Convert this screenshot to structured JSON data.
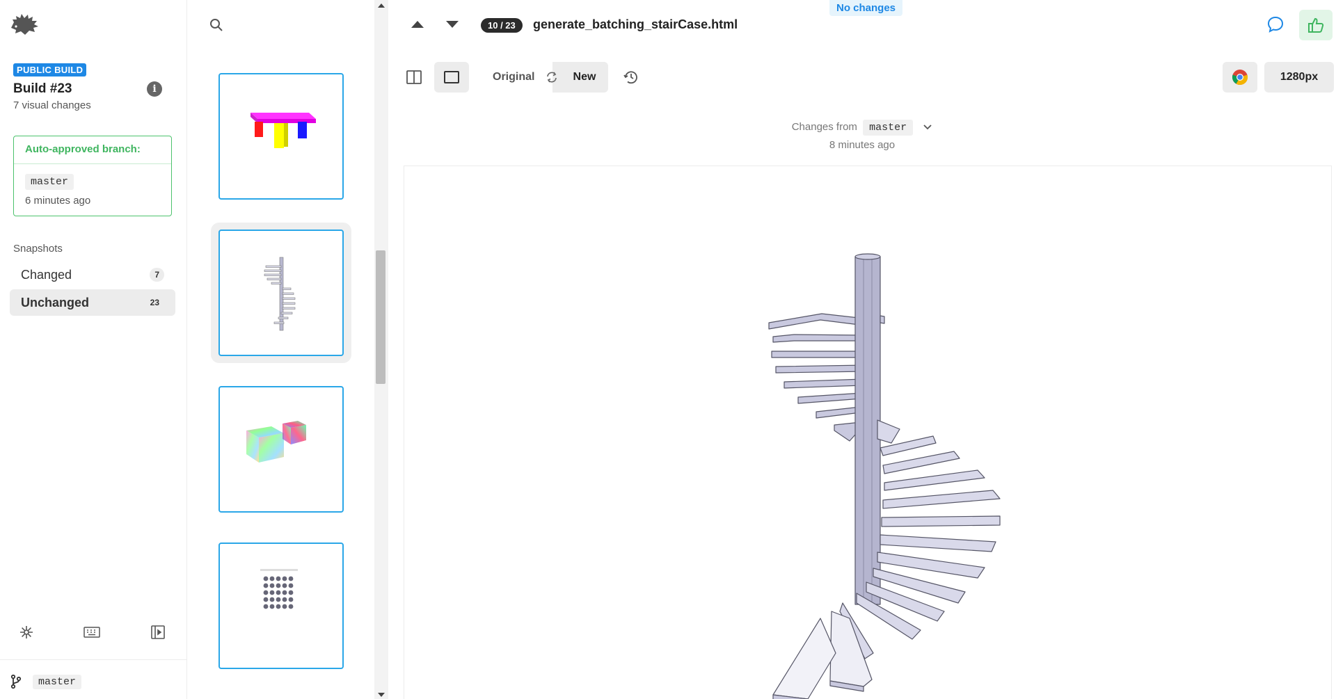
{
  "sidebar": {
    "badge": "PUBLIC BUILD",
    "build_title": "Build #23",
    "build_sub": "7 visual changes",
    "auto_approved": {
      "heading": "Auto-approved branch:",
      "branch": "master",
      "time": "6 minutes ago"
    },
    "snapshots_label": "Snapshots",
    "changed": {
      "label": "Changed",
      "count": "7"
    },
    "unchanged": {
      "label": "Unchanged",
      "count": "23"
    },
    "footer_branch": "master"
  },
  "main": {
    "status_tab": "No changes",
    "counter": "10 / 23",
    "file_name": "generate_batching_stairCase.html",
    "toggle_original": "Original",
    "toggle_new": "New",
    "viewport": "1280px",
    "changes_from_label": "Changes from",
    "changes_from_branch": "master",
    "changes_time": "8 minutes ago"
  },
  "colors": {
    "accent_blue": "#1e88e5",
    "thumb_border": "#2aa7e8",
    "approve_green": "#4cc26c",
    "stair_face": "#c9c9df",
    "stair_edge": "#555566"
  },
  "icons": {
    "logo": "hedgehog-logo-icon",
    "info": "info-icon",
    "search": "search-icon",
    "comment": "comment-icon",
    "approve": "thumbs-up-icon",
    "split_view": "split-view-icon",
    "single_view": "single-view-icon",
    "swap": "swap-icon",
    "history": "history-icon",
    "browser": "chrome-icon"
  }
}
